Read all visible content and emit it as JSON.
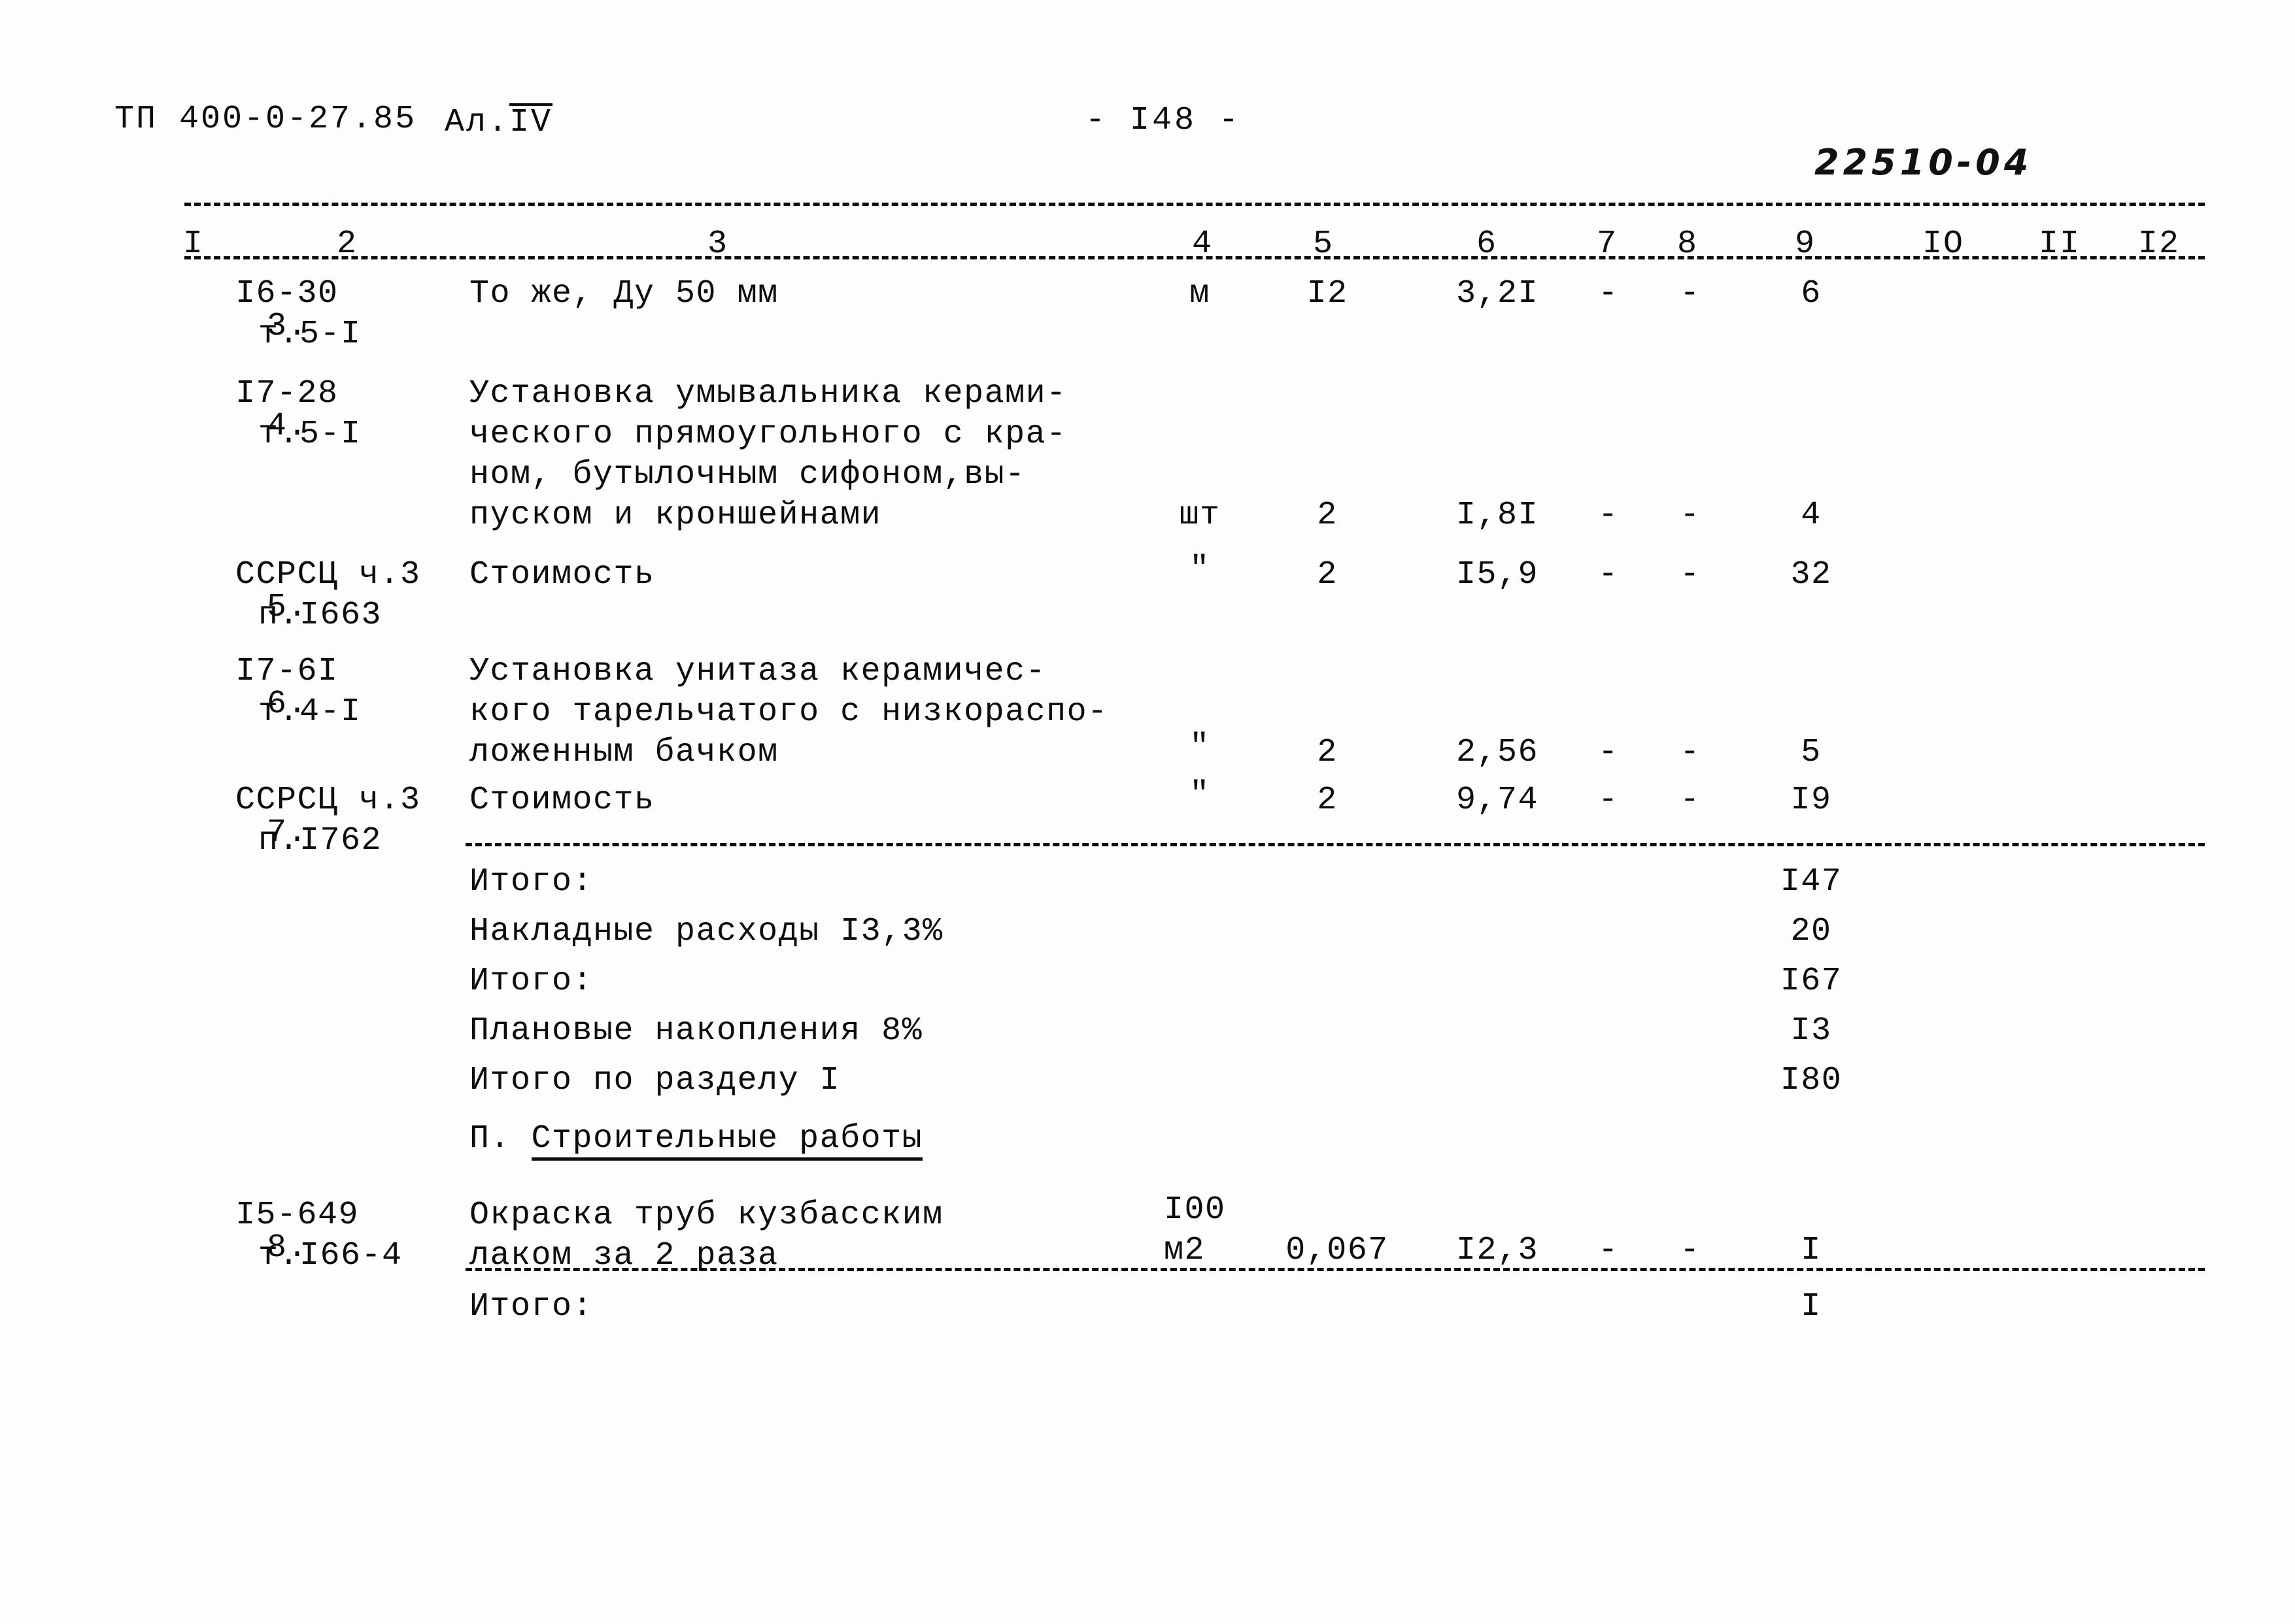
{
  "header": {
    "doc_code": "ТП 400-0-27.85",
    "album_prefix": "Ал.",
    "album_roman": "IV",
    "page_number": "- I48 -",
    "handwritten_code": "22510-04"
  },
  "table": {
    "column_headers": [
      "I",
      "2",
      "3",
      "4",
      "5",
      "6",
      "7",
      "8",
      "9",
      "IO",
      "II",
      "I2"
    ],
    "rows": [
      {
        "no": "3.",
        "code_line1": "I6-30",
        "code_line2": "т.5-I",
        "desc_lines": [
          "То же, Ду 50 мм"
        ],
        "unit": "м",
        "qty": "I2",
        "price": "3,2I",
        "c7": "-",
        "c8": "-",
        "c9": "6"
      },
      {
        "no": "4.",
        "code_line1": "I7-28",
        "code_line2": "т.5-I",
        "desc_lines": [
          "Установка умывальника керами-",
          "ческого прямоугольного с кра-",
          "ном, бутылочным сифоном,вы-",
          "пуском и кроншейнами"
        ],
        "unit": "шт",
        "qty": "2",
        "price": "I,8I",
        "c7": "-",
        "c8": "-",
        "c9": "4"
      },
      {
        "no": "5.",
        "code_line1": "ССРСЦ ч.3",
        "code_line2": "п.I663",
        "desc_lines": [
          "Стоимость"
        ],
        "unit": "\"",
        "qty": "2",
        "price": "I5,9",
        "c7": "-",
        "c8": "-",
        "c9": "32"
      },
      {
        "no": "6.",
        "code_line1": "I7-6I",
        "code_line2": "т.4-I",
        "desc_lines": [
          "Установка унитаза керамичес-",
          "кого тарельчатого с низкораспо-",
          "ложенным бачком"
        ],
        "unit": "\"",
        "qty": "2",
        "price": "2,56",
        "c7": "-",
        "c8": "-",
        "c9": "5"
      },
      {
        "no": "7.",
        "code_line1": "ССРСЦ ч.3",
        "code_line2": "п.I762",
        "desc_lines": [
          "Стоимость"
        ],
        "unit": "\"",
        "qty": "2",
        "price": "9,74",
        "c7": "-",
        "c8": "-",
        "c9": "I9"
      }
    ],
    "totals_block_1": [
      {
        "label": "Итого:",
        "value": "I47"
      },
      {
        "label": "Накладные расходы I3,3%",
        "value": "20"
      },
      {
        "label": "Итого:",
        "value": "I67"
      },
      {
        "label": "Плановые накопления 8%",
        "value": "I3"
      },
      {
        "label": "Итого по разделу I",
        "value": "I80"
      }
    ],
    "section_heading": {
      "number": "П.",
      "title": "Строительные работы"
    },
    "row_8": {
      "no": "8.",
      "code_line1": "I5-649",
      "code_line2": "т.I66-4",
      "desc_lines": [
        "Окраска труб кузбасским",
        "лаком за 2 раза"
      ],
      "unit_line1": "I00",
      "unit_line2": "м2",
      "qty": "0,067",
      "price": "I2,3",
      "c7": "-",
      "c8": "-",
      "c9": "I"
    },
    "totals_block_2": [
      {
        "label": "Итого:",
        "value": "I"
      }
    ]
  }
}
